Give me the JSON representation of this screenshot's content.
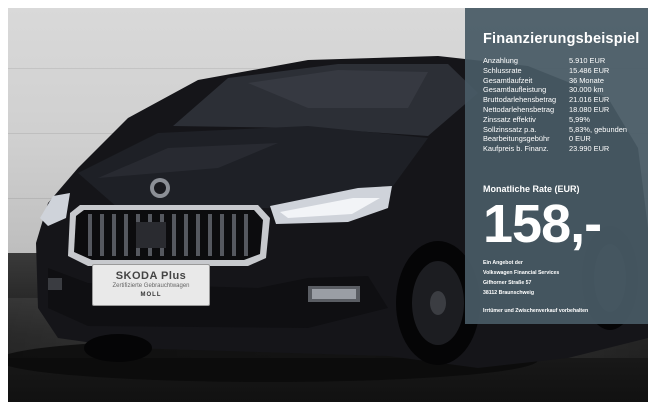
{
  "plate": {
    "brand": "SKODA Plus",
    "subtitle": "Zertifizierte Gebrauchtwagen",
    "dealer": "MOLL"
  },
  "finance": {
    "title": "Finanzierungsbeispiel",
    "rows": [
      {
        "label": "Anzahlung",
        "value": "5.910 EUR"
      },
      {
        "label": "Schlussrate",
        "value": "15.486 EUR"
      },
      {
        "label": "Gesamtlaufzeit",
        "value": "36 Monate"
      },
      {
        "label": "Gesamtlaufleistung",
        "value": "30.000 km"
      },
      {
        "label": "Bruttodarlehensbetrag",
        "value": "21.016 EUR"
      },
      {
        "label": "Nettodarlehensbetrag",
        "value": "18.080 EUR"
      },
      {
        "label": "Zinssatz effektiv",
        "value": "5,99%"
      },
      {
        "label": "Sollzinssatz p.a.",
        "value": "5,83%, gebunden"
      },
      {
        "label": "Bearbeitungsgebühr",
        "value": "0 EUR"
      },
      {
        "label": "Kaufpreis b. Finanz.",
        "value": "23.990 EUR"
      }
    ],
    "rate_label": "Monatliche Rate (EUR)",
    "rate_value": "158,-",
    "offer": {
      "line1": "Ein Angebot der",
      "line2": "Volkswagen Financial Services",
      "line3": "Gifhorner Straße 57",
      "line4": "38112 Braunschweig"
    },
    "disclaimer": "Irrtümer und Zwischenverkauf vorbehalten"
  },
  "colors": {
    "panel": "#485a65",
    "car_body": "#151519",
    "wall": "#d4d4d4"
  },
  "icons": [
    "skoda-logo-icon"
  ]
}
